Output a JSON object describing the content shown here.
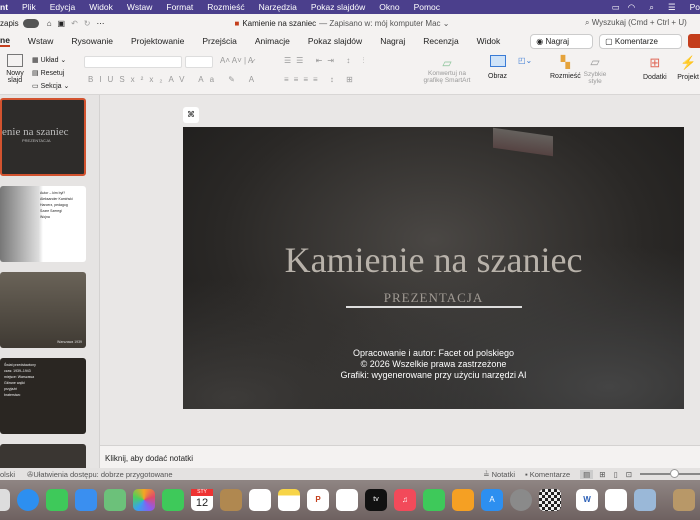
{
  "menubar": {
    "items": [
      "nt",
      "Plik",
      "Edycja",
      "Widok",
      "Wstaw",
      "Format",
      "Rozmieść",
      "Narzędzia",
      "Pokaz slajdów",
      "Okno",
      "Pomoc"
    ],
    "right": "Po"
  },
  "titlebar": {
    "autosave": "zapis",
    "doc_title": "Kamienie na szaniec",
    "saved": "— Zapisano w: mój komputer Mac ⌄",
    "search_placeholder": "Wyszukaj (Cmd + Ctrl + U)"
  },
  "tabs": [
    "ne",
    "Wstaw",
    "Rysowanie",
    "Projektowanie",
    "Przejścia",
    "Animacje",
    "Pokaz slajdów",
    "Nagraj",
    "Recenzja",
    "Widok"
  ],
  "tab_buttons": {
    "record": "Nagraj",
    "comments": "Komentarze"
  },
  "ribbon": {
    "new_slide": "Nowy slajd",
    "layout": "Układ",
    "reset": "Resetuj",
    "section": "Sekcja",
    "smartart": "Konwertuj na grafikę SmartArt",
    "picture": "Obraz",
    "arrange": "Rozmieść",
    "quick_styles": "Szybkie style",
    "addins": "Dodatki",
    "designer": "Projekt"
  },
  "slide": {
    "title": "Kamienie na szaniec",
    "subtitle": "PREZENTACJA",
    "lines": [
      "Opracowanie i autor: Facet od polskiego",
      "© 2026 Wszelkie prawa zastrzeżone",
      "Grafiki: wygenerowane przy użyciu narzędzi AI"
    ]
  },
  "thumbnails": [
    {
      "title": "enie na szaniec",
      "sub": "PREZENTACJA"
    },
    {
      "items": [
        "Autor – kim był?",
        "Aleksander Kamiński",
        "Harcerz, pedagog",
        "Szare Szeregi",
        "Wojna"
      ]
    },
    {
      "caption": "Warszawa 1939"
    },
    {
      "items": [
        "Świat przedstawiony",
        "czas: 1939–1943",
        "miejsce: Warszawa",
        "Główne wątki",
        "przyjaźń",
        "braterstwo",
        "walka"
      ]
    },
    {}
  ],
  "notes": {
    "placeholder": "Kliknij, aby dodać notatki"
  },
  "status": {
    "language": "olski",
    "accessibility": "Ułatwienia dostępu: dobrze przygotowane",
    "notes": "Notatki",
    "comments": "Komentarze"
  },
  "dock": {
    "calendar_month": "STY",
    "calendar_day": "12",
    "apps": [
      "launchpad",
      "safari",
      "messages",
      "mail",
      "maps",
      "photos",
      "facetime",
      "calendar",
      "contacts",
      "reminders",
      "notes",
      "powerpoint",
      "freeform",
      "tv",
      "music",
      "numbers",
      "pages",
      "app-store",
      "system-settings",
      "chess",
      "word",
      "preview",
      "image-capture",
      "photo"
    ]
  },
  "colors": {
    "menubar": "#4b3f8c",
    "accent": "#c43e1c",
    "slide_title": "#b8b2aa"
  }
}
